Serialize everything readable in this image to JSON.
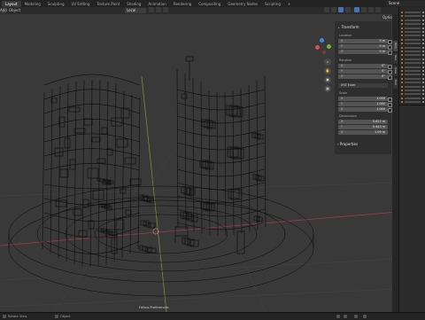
{
  "topbar": {
    "tabs": [
      "Layout",
      "Modeling",
      "Sculpting",
      "UV Editing",
      "Texture Paint",
      "Shading",
      "Animation",
      "Rendering",
      "Compositing",
      "Geometry Nodes",
      "Scripting",
      "+"
    ],
    "active_tab": "Layout",
    "scene_label": "Scene"
  },
  "viewport_header": {
    "menu_add": "Add",
    "menu_object": "Object",
    "transform_orientation": "Local",
    "options_label": "Options"
  },
  "transform_panel": {
    "title": "Transform",
    "location_label": "Location",
    "location": [
      {
        "axis": "X",
        "value": "0 m"
      },
      {
        "axis": "Y",
        "value": "0 m"
      },
      {
        "axis": "Z",
        "value": "0 m"
      }
    ],
    "rotation_label": "Rotation",
    "rotation": [
      {
        "axis": "X",
        "value": "0°"
      },
      {
        "axis": "Y",
        "value": "0°"
      },
      {
        "axis": "Z",
        "value": "0°"
      }
    ],
    "rotation_mode": "XYZ Euler",
    "scale_label": "Scale",
    "scale": [
      {
        "axis": "X",
        "value": "1.000"
      },
      {
        "axis": "Y",
        "value": "1.000"
      },
      {
        "axis": "Z",
        "value": "1.000"
      }
    ],
    "dimensions_label": "Dimensions",
    "dimensions": [
      {
        "axis": "X",
        "value": "0.622 m"
      },
      {
        "axis": "Y",
        "value": "0.443 m"
      },
      {
        "axis": "Z",
        "value": "1.09 m"
      }
    ],
    "properties_title": "Properties"
  },
  "gizmo": {
    "x_color": "#e24a55",
    "y_color": "#79b629",
    "z_color": "#3f88e0"
  },
  "status_bar": {
    "left_text": "Rotate View",
    "mid_text": "Object"
  },
  "viewport_overlay": {
    "popup_text": "Follow Preferences"
  },
  "colors": {
    "viewport_bg": "#393939",
    "wire": "#0a0a0a",
    "x_axis": "#b0384a",
    "y_axis": "#8aa53a",
    "accent": "#4772b3"
  }
}
